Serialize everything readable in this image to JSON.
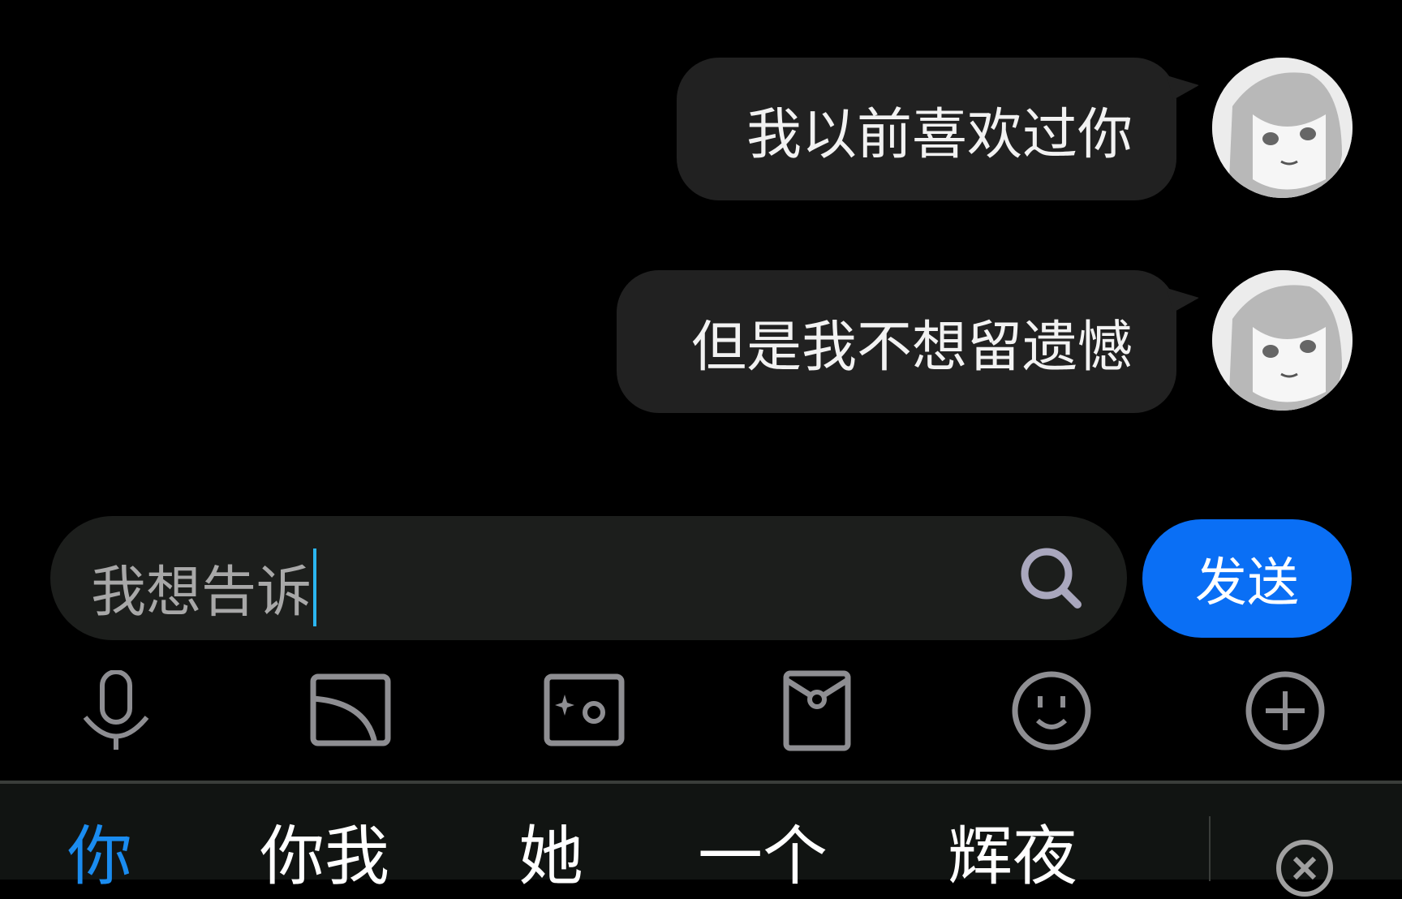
{
  "messages": [
    {
      "text": "我以前喜欢过你",
      "sender": "self"
    },
    {
      "text": "但是我不想留遗憾",
      "sender": "self"
    }
  ],
  "composer": {
    "value": "我想告诉",
    "search_icon": "search-icon",
    "send_label": "发送"
  },
  "toolbar": {
    "icons": [
      "microphone-icon",
      "image-icon",
      "camera-icon",
      "red-packet-icon",
      "emoji-icon",
      "plus-icon"
    ]
  },
  "keyboard": {
    "candidates": [
      "你",
      "你我",
      "她",
      "一个",
      "辉夜"
    ],
    "selected_index": 0,
    "close_icon": "close-icon"
  },
  "colors": {
    "accent": "#0a6ff5",
    "selected_candidate": "#1a8cf0",
    "bubble": "#212121",
    "caret": "#2bb6f0"
  }
}
